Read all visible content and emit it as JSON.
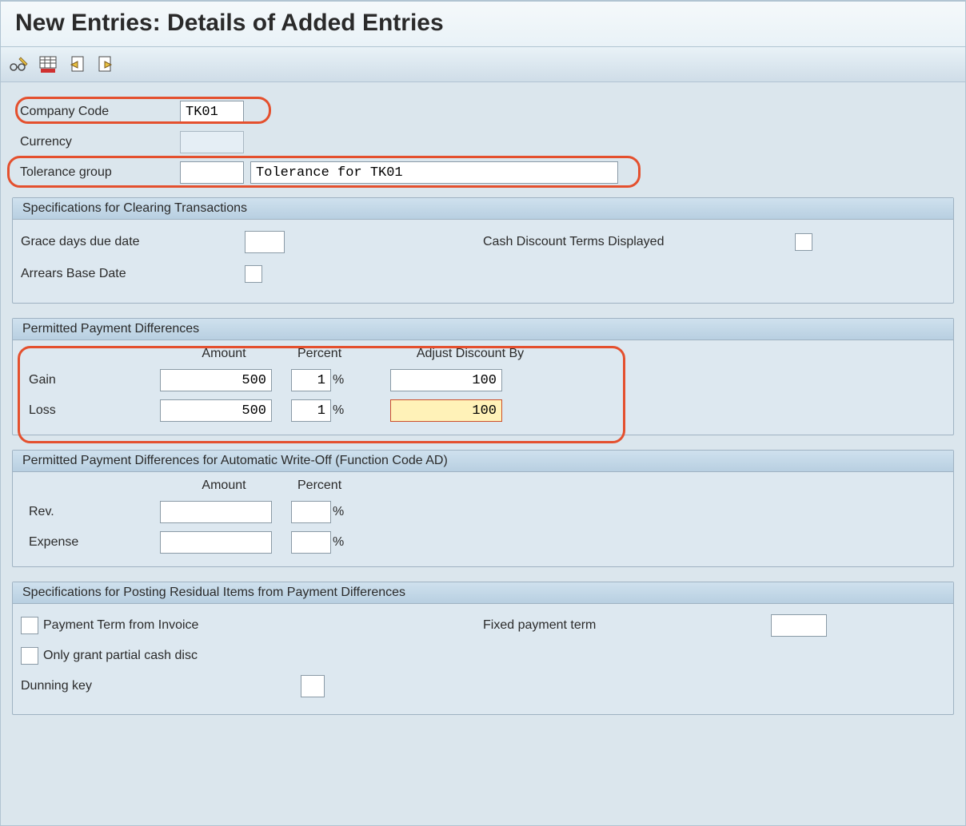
{
  "page": {
    "title": "New Entries: Details of Added Entries"
  },
  "header": {
    "companyCodeLabel": "Company Code",
    "companyCodeValue": "TK01",
    "currencyLabel": "Currency",
    "currencyValue": "",
    "toleranceGroupLabel": "Tolerance group",
    "toleranceGroupValue": "",
    "toleranceGroupDesc": "Tolerance for TK01"
  },
  "section1": {
    "title": "Specifications for Clearing Transactions",
    "graceDaysLabel": "Grace days due date",
    "cashDiscLabel": "Cash Discount Terms Displayed",
    "arrearsLabel": "Arrears Base Date"
  },
  "section2": {
    "title": "Permitted Payment Differences",
    "colAmount": "Amount",
    "colPercent": "Percent",
    "colAdjust": "Adjust Discount By",
    "gainLabel": "Gain",
    "gainAmount": "500",
    "gainPercent": "1",
    "gainAdjust": "100",
    "lossLabel": "Loss",
    "lossAmount": "500",
    "lossPercent": "1",
    "lossAdjust": "100"
  },
  "section3": {
    "title": "Permitted Payment Differences for Automatic Write-Off (Function Code AD)",
    "colAmount": "Amount",
    "colPercent": "Percent",
    "revLabel": "Rev.",
    "expenseLabel": "Expense"
  },
  "section4": {
    "title": "Specifications for Posting Residual Items from Payment Differences",
    "paymentTermInvoiceLabel": "Payment Term from Invoice",
    "fixedPaymentTermLabel": "Fixed payment term",
    "partialCashDiscLabel": "Only grant partial cash disc",
    "dunningKeyLabel": "Dunning key"
  },
  "misc": {
    "percentSign": "%"
  }
}
